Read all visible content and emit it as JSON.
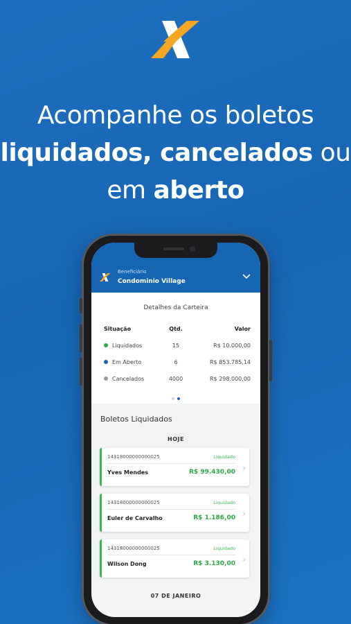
{
  "headline": {
    "line1": "Acompanhe os boletos",
    "line2_a": "liquidados",
    "line2_b": ", ",
    "line2_c": "cancelados",
    "line2_d": " ou",
    "line3_a": "em ",
    "line3_b": "aberto"
  },
  "app": {
    "beneficiary_label": "Beneficiário",
    "beneficiary_name": "Condominio Village"
  },
  "wallet": {
    "title": "Detalhes da Carteira",
    "headers": {
      "status": "Situação",
      "qty": "Qtd.",
      "value": "Valor"
    },
    "rows": [
      {
        "status": "Liquidados",
        "qty": "15",
        "value": "R$ 10.000,00",
        "color": "#2aa845"
      },
      {
        "status": "Em Aberto",
        "qty": "6",
        "value": "R$ 853.785,14",
        "color": "#1766b4"
      },
      {
        "status": "Cancelados",
        "qty": "4000",
        "value": "R$ 298.000,00",
        "color": "#9a9a9a"
      }
    ],
    "pager": {
      "pages": 2,
      "active": 2
    }
  },
  "list": {
    "title": "Boletos Liquidados",
    "section_today": "HOJE",
    "items": [
      {
        "code": "14318000000000025",
        "status": "Liquidado",
        "payer": "Yves Mendes",
        "amount": "R$ 99.430,00"
      },
      {
        "code": "14318000000000025",
        "status": "Liquidado",
        "payer": "Euler de Carvalho",
        "amount": "R$ 1.186,00"
      },
      {
        "code": "14318000000000025",
        "status": "Liquidado",
        "payer": "Wilson Dong",
        "amount": "R$ 3.130,00"
      }
    ],
    "section_next": "07 DE JANEIRO"
  },
  "colors": {
    "brand_blue": "#1766b4",
    "logo_orange": "#f6a623",
    "success_green": "#2aa845"
  },
  "icons": {
    "logo": "caixa-x-logo-icon",
    "chevron": "chevron-down-icon",
    "arrow": "chevron-right-icon"
  }
}
